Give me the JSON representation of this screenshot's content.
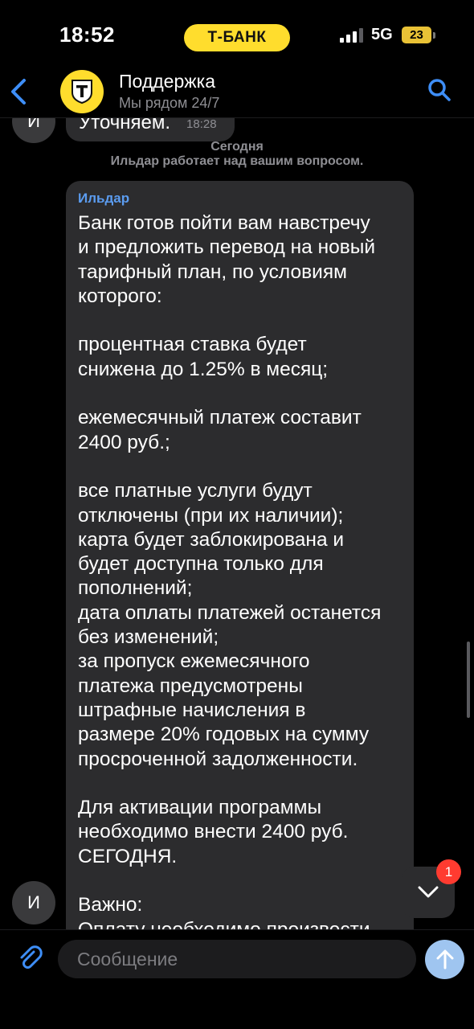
{
  "status_bar": {
    "time": "18:52",
    "brand": "Т‑БАНК",
    "network": "5G",
    "battery": "23"
  },
  "header": {
    "back_icon": "chevron-left-icon",
    "title": "Поддержка",
    "subtitle": "Мы рядом 24/7",
    "search_icon": "search-icon"
  },
  "chat": {
    "previous_message": {
      "avatar_letter": "И",
      "text": "Уточняем.",
      "time": "18:28"
    },
    "date_separator": "Сегодня",
    "system_note": "Ильдар работает над вашим вопросом.",
    "message": {
      "sender": "Ильдар",
      "avatar_letter": "И",
      "text": "Банк готов пойти вам навстречу\nи предложить перевод на новый\nтарифный план, по условиям\nкоторого:\n\nпроцентная ставка будет\nснижена до 1.25% в месяц;\n\nежемесячный платеж составит\n2400 руб.;\n\nвсе платные услуги будут\nотключены (при их наличии);\nкарта будет заблокирована и\nбудет доступна только для\nпополнений;\nдата оплаты платежей останется\nбез изменений;\nза пропуск ежемесячного\nплатежа предусмотрены\nштрафные начисления в\nразмере 20% годовых на сумму\nпросроченной задолженности.\n\nДля активации программы\nнеобходимо внести 2400 руб.\nСЕГОДНЯ.\n\nВажно:\nОплату необходимо произвести"
    },
    "unread_count": "1"
  },
  "input": {
    "placeholder": "Сообщение",
    "value": ""
  },
  "colors": {
    "brand_yellow": "#ffdd2d",
    "accent_blue": "#5b9cf0",
    "bubble": "#2c2c2e",
    "badge_red": "#ff3b30"
  }
}
